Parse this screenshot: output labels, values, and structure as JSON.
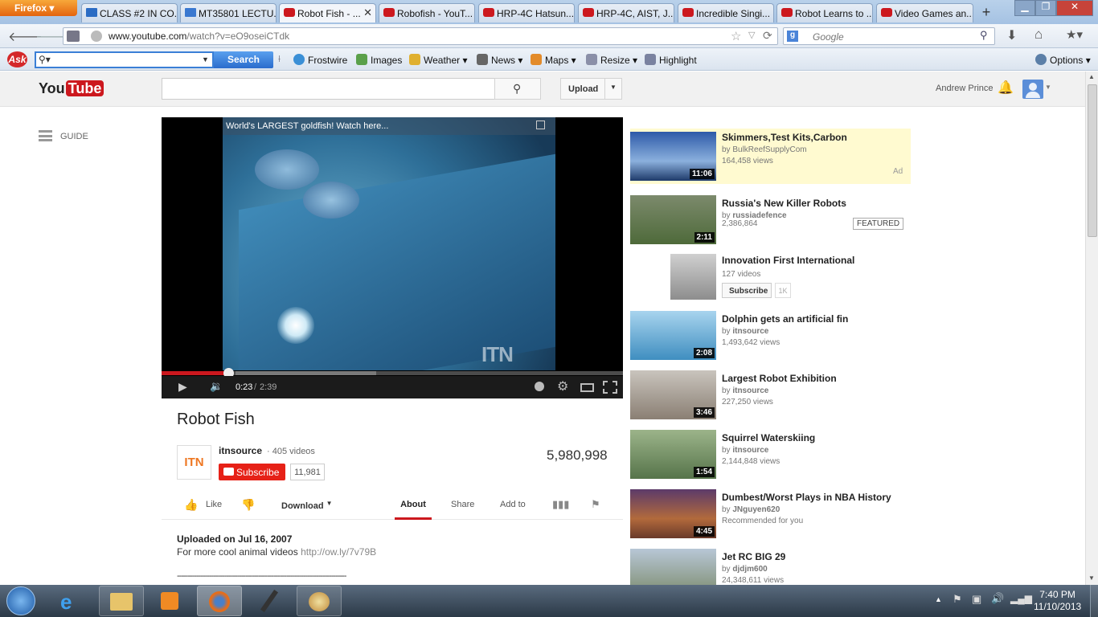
{
  "browser": {
    "firefox_label": "Firefox",
    "tabs": [
      {
        "label": "CLASS #2 IN CO...",
        "icon": "doc-icon"
      },
      {
        "label": "MT35801 LECTU...",
        "icon": "doc-icon"
      },
      {
        "label": "Robot Fish - ...",
        "icon": "youtube-icon",
        "active": true
      },
      {
        "label": "Robofish - YouT...",
        "icon": "youtube-icon"
      },
      {
        "label": "HRP-4C Hatsun...",
        "icon": "youtube-icon"
      },
      {
        "label": "HRP-4C, AIST, J...",
        "icon": "youtube-icon"
      },
      {
        "label": "Incredible Singi...",
        "icon": "youtube-icon"
      },
      {
        "label": "Robot Learns to ...",
        "icon": "youtube-icon"
      },
      {
        "label": "Video Games an...",
        "icon": "youtube-icon"
      }
    ],
    "url_host": "www.youtube.com",
    "url_path": "/watch?v=eO9oseiCTdk",
    "search_placeholder": "Google"
  },
  "toolbar": {
    "ask_logo": "Ask",
    "search_button": "Search",
    "items": [
      "Frostwire",
      "Images",
      "Weather",
      "News",
      "Maps",
      "Resize",
      "Highlight"
    ],
    "options": "Options"
  },
  "youtube": {
    "logo_you": "You",
    "logo_tube": "Tube",
    "upload": "Upload",
    "user": "Andrew Prince",
    "guide": "GUIDE"
  },
  "player": {
    "overlay_title": "World's LARGEST goldfish! Watch here...",
    "watermark": "ITN",
    "current_time": "0:23",
    "duration": "2:39",
    "progress_fraction": 0.145
  },
  "video": {
    "title": "Robot Fish",
    "channel": "itnsource",
    "channel_icon_text": "ITN",
    "channel_videos": "· 405 videos",
    "subscribe": "Subscribe",
    "subscriber_count": "11,981",
    "views": "5,980,998",
    "like": "Like",
    "download": "Download",
    "tabs": [
      "About",
      "Share",
      "Add to"
    ],
    "uploaded": "Uploaded on Jul 16, 2007",
    "description": "For more cool animal videos",
    "link": "http://ow.ly/7v79B",
    "separator": "-------------------------------------------------------------------------------"
  },
  "related": [
    {
      "title": "Skimmers,Test Kits,Carbon",
      "by": "by BulkReefSupplyCom",
      "views": "164,458 views",
      "duration": "11:06",
      "ad": "Ad"
    },
    {
      "title": "Russia's New Killer Robots",
      "by_prefix": "by",
      "by_name": "russiadefence",
      "views": "2,386,864",
      "duration": "2:11",
      "badge": "FEATURED"
    },
    {
      "title": "Innovation First International",
      "views": "127 videos",
      "subscribe": "Subscribe",
      "count": "1K"
    },
    {
      "title": "Dolphin gets an artificial fin",
      "by_prefix": "by",
      "by_name": "itnsource",
      "views": "1,493,642 views",
      "duration": "2:08"
    },
    {
      "title": "Largest Robot Exhibition",
      "by_prefix": "by",
      "by_name": "itnsource",
      "views": "227,250 views",
      "duration": "3:46"
    },
    {
      "title": "Squirrel Waterskiing",
      "by_prefix": "by",
      "by_name": "itnsource",
      "views": "2,144,848 views",
      "duration": "1:54"
    },
    {
      "title": "Dumbest/Worst Plays in NBA History",
      "by_prefix": "by",
      "by_name": "JNguyen620",
      "views": "Recommended for you",
      "duration": "4:45"
    },
    {
      "title": "Jet RC BIG 29",
      "by_prefix": "by",
      "by_name": "djdjm600",
      "views": "24,348,611 views"
    }
  ],
  "taskbar": {
    "time": "7:40 PM",
    "date": "11/10/2013"
  }
}
